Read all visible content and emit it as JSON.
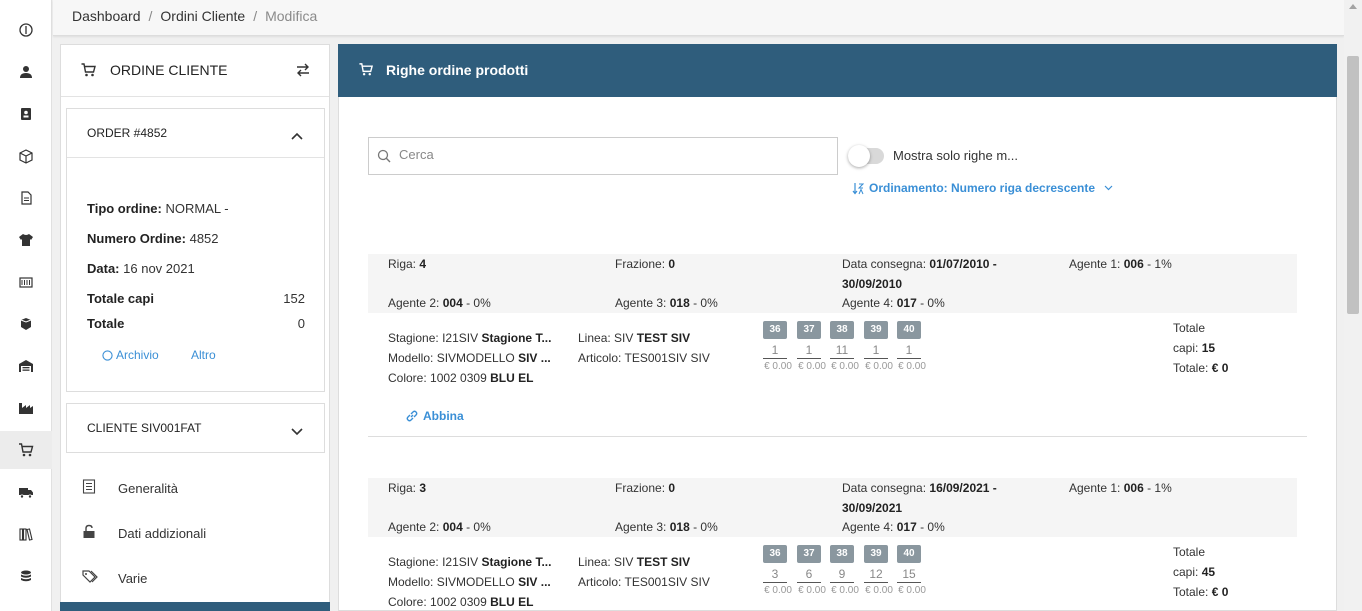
{
  "breadcrumb": {
    "items": [
      "Dashboard",
      "Ordini Cliente"
    ],
    "current": "Modifica"
  },
  "rail": {
    "icons": [
      "info-icon",
      "user-icon",
      "contacts-icon",
      "box-icon",
      "document-icon",
      "tshirt-icon",
      "barcode-icon",
      "cubes-icon",
      "warehouse-icon",
      "factory-icon",
      "cart-icon",
      "truck-icon",
      "books-icon",
      "coins-icon"
    ],
    "active_index": 10
  },
  "left_panel": {
    "title": "ORDINE CLIENTE",
    "order": {
      "title": "ORDER #4852",
      "tipo_label": "Tipo ordine:",
      "tipo_value": "NORMAL -",
      "numero_label": "Numero Ordine:",
      "numero_value": "4852",
      "data_label": "Data:",
      "data_value": "16 nov 2021",
      "totale_capi_label": "Totale capi",
      "totale_capi_value": "152",
      "totale_label": "Totale",
      "totale_value": "0",
      "archivio_label": "Archivio",
      "altro_label": "Altro"
    },
    "cliente": {
      "title": "CLIENTE SIV001FAT"
    },
    "menu": [
      {
        "label": "Generalità",
        "icon": "list-icon"
      },
      {
        "label": "Dati addizionali",
        "icon": "lock-open-icon"
      },
      {
        "label": "Varie",
        "icon": "tags-icon"
      }
    ]
  },
  "main": {
    "title": "Righe ordine prodotti",
    "search_placeholder": "Cerca",
    "toggle_label": "Mostra solo righe m...",
    "toggle_on": false,
    "sort_label": "Ordinamento: Numero riga decrescente",
    "labels": {
      "riga": "Riga:",
      "frazione": "Frazione:",
      "data_consegna": "Data consegna:",
      "agente1": "Agente 1:",
      "agente2": "Agente 2:",
      "agente3": "Agente 3:",
      "agente4": "Agente 4:",
      "stagione": "Stagione:",
      "modello": "Modello:",
      "colore": "Colore:",
      "linea": "Linea:",
      "articolo": "Articolo:",
      "totale": "Totale",
      "capi": "capi:",
      "totale_euro": "Totale:",
      "abbina": "Abbina"
    },
    "rows": [
      {
        "riga": "4",
        "frazione": "0",
        "data_consegna_1": "01/07/2010 -",
        "data_consegna_2": "30/09/2010",
        "agente1_code": "006",
        "agente1_pct": "- 1%",
        "agente2_code": "004",
        "agente2_pct": "- 0%",
        "agente3_code": "018",
        "agente3_pct": "- 0%",
        "agente4_code": "017",
        "agente4_pct": "- 0%",
        "stagione_code": "I21SIV",
        "stagione_name": "Stagione T...",
        "modello_code": "SIVMODELLO",
        "modello_name": "SIV ...",
        "colore_code": "1002 0309",
        "colore_name": "BLU EL",
        "linea_code": "SIV",
        "linea_name": "TEST SIV",
        "articolo": "TES001SIV SIV",
        "sizes": [
          {
            "size": "36",
            "qty": "1",
            "price": "€ 0.00"
          },
          {
            "size": "37",
            "qty": "1",
            "price": "€ 0.00"
          },
          {
            "size": "38",
            "qty": "11",
            "price": "€ 0.00"
          },
          {
            "size": "39",
            "qty": "1",
            "price": "€ 0.00"
          },
          {
            "size": "40",
            "qty": "1",
            "price": "€ 0.00"
          }
        ],
        "totale_capi": "15",
        "totale": "€ 0"
      },
      {
        "riga": "3",
        "frazione": "0",
        "data_consegna_1": "16/09/2021 -",
        "data_consegna_2": "30/09/2021",
        "agente1_code": "006",
        "agente1_pct": "- 1%",
        "agente2_code": "004",
        "agente2_pct": "- 0%",
        "agente3_code": "018",
        "agente3_pct": "- 0%",
        "agente4_code": "017",
        "agente4_pct": "- 0%",
        "stagione_code": "I21SIV",
        "stagione_name": "Stagione T...",
        "modello_code": "SIVMODELLO",
        "modello_name": "SIV ...",
        "colore_code": "1002 0309",
        "colore_name": "BLU EL",
        "linea_code": "SIV",
        "linea_name": "TEST SIV",
        "articolo": "TES001SIV SIV",
        "sizes": [
          {
            "size": "36",
            "qty": "3",
            "price": "€ 0.00"
          },
          {
            "size": "37",
            "qty": "6",
            "price": "€ 0.00"
          },
          {
            "size": "38",
            "qty": "9",
            "price": "€ 0.00"
          },
          {
            "size": "39",
            "qty": "12",
            "price": "€ 0.00"
          },
          {
            "size": "40",
            "qty": "15",
            "price": "€ 0.00"
          }
        ],
        "totale_capi": "45",
        "totale": "€ 0"
      }
    ]
  }
}
